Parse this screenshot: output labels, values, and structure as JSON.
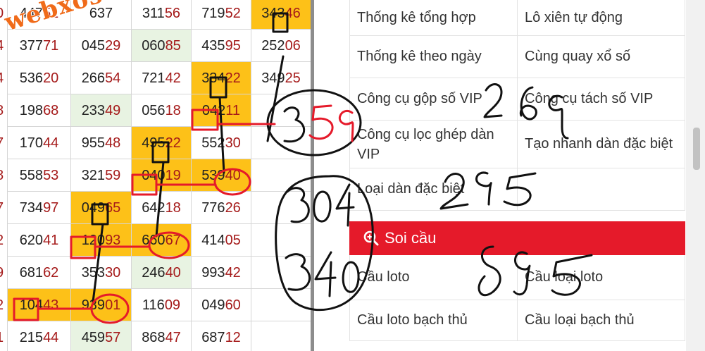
{
  "lotto_rows": [
    {
      "lead": "0",
      "cells": [
        [
          "447",
          "51"
        ],
        [
          "637",
          ""
        ],
        [
          "311",
          "56"
        ],
        [
          "719",
          "52"
        ],
        [
          "343",
          "46"
        ]
      ],
      "hl": [
        null,
        null,
        null,
        null,
        "yellow"
      ]
    },
    {
      "lead": "4",
      "cells": [
        [
          "377",
          "71"
        ],
        [
          "045",
          "29"
        ],
        [
          "060",
          "85"
        ],
        [
          "435",
          "95"
        ],
        [
          "252",
          "06"
        ]
      ],
      "hl": [
        null,
        null,
        "green",
        null,
        null
      ]
    },
    {
      "lead": "4",
      "cells": [
        [
          "536",
          "20"
        ],
        [
          "266",
          "54"
        ],
        [
          "721",
          "42"
        ],
        [
          "334",
          "22"
        ],
        [
          "349",
          "25"
        ]
      ],
      "hl": [
        null,
        null,
        null,
        "yellow",
        null
      ]
    },
    {
      "lead": "8",
      "cells": [
        [
          "198",
          "68"
        ],
        [
          "233",
          "49"
        ],
        [
          "056",
          "18"
        ],
        [
          "042",
          "11"
        ],
        [
          "",
          ""
        ]
      ],
      "hl": [
        null,
        "green",
        null,
        "yellow",
        null
      ]
    },
    {
      "lead": "7",
      "cells": [
        [
          "170",
          "44"
        ],
        [
          "955",
          "48"
        ],
        [
          "495",
          "22"
        ],
        [
          "552",
          "30"
        ],
        [
          "",
          ""
        ]
      ],
      "hl": [
        null,
        null,
        "yellow",
        null,
        null
      ]
    },
    {
      "lead": "8",
      "cells": [
        [
          "558",
          "53"
        ],
        [
          "321",
          "59"
        ],
        [
          "040",
          "19"
        ],
        [
          "539",
          "40"
        ],
        [
          "",
          ""
        ]
      ],
      "hl": [
        null,
        null,
        "yellow",
        "yellow",
        null
      ]
    },
    {
      "lead": "7",
      "cells": [
        [
          "734",
          "97"
        ],
        [
          "049",
          "65"
        ],
        [
          "642",
          "18"
        ],
        [
          "776",
          "26"
        ],
        [
          "",
          ""
        ]
      ],
      "hl": [
        null,
        "yellow",
        null,
        null,
        null
      ]
    },
    {
      "lead": "2",
      "cells": [
        [
          "620",
          "41"
        ],
        [
          "120",
          "93"
        ],
        [
          "660",
          "67"
        ],
        [
          "414",
          "05"
        ],
        [
          "",
          ""
        ]
      ],
      "hl": [
        null,
        "yellow",
        "yellow",
        null,
        null
      ]
    },
    {
      "lead": "9",
      "cells": [
        [
          "681",
          "62"
        ],
        [
          "353",
          "30"
        ],
        [
          "246",
          "40"
        ],
        [
          "993",
          "42"
        ],
        [
          "",
          ""
        ]
      ],
      "hl": [
        null,
        null,
        "green",
        null,
        null
      ]
    },
    {
      "lead": "2",
      "cells": [
        [
          "104",
          "43"
        ],
        [
          "939",
          "01"
        ],
        [
          "116",
          "09"
        ],
        [
          "049",
          "60"
        ],
        [
          "",
          ""
        ]
      ],
      "hl": [
        "yellow",
        "yellow",
        null,
        null,
        null
      ]
    },
    {
      "lead": "1",
      "cells": [
        [
          "215",
          "44"
        ],
        [
          "459",
          "57"
        ],
        [
          "868",
          "47"
        ],
        [
          "687",
          "12"
        ],
        [
          "",
          ""
        ]
      ],
      "hl": [
        null,
        "green",
        null,
        null,
        null
      ]
    }
  ],
  "watermark": "webxoso.net",
  "menu": {
    "items": [
      {
        "left": "Thống kê tổng hợp",
        "right": "Lô xiên tự động"
      },
      {
        "left": "Thống kê theo ngày",
        "right": "Cùng quay xổ số"
      },
      {
        "left": "Công cụ gộp số VIP",
        "right": "Công cụ tách số VIP"
      },
      {
        "left": "Công cụ lọc ghép dàn VIP",
        "right": "Tạo nhanh dàn đặc biệt"
      },
      {
        "left": "Loại dàn đặc biệt",
        "right": ""
      }
    ],
    "section_title": "Soi cầu",
    "section_items": [
      {
        "left": "Cầu loto",
        "right": "Cầu loại loto"
      },
      {
        "left": "Cầu loto bạch thủ",
        "right": "Cầu loại bạch thủ"
      }
    ]
  },
  "handwriting": {
    "n359": "359",
    "n269": "269",
    "n295": "295",
    "n304": "304",
    "n340": "340",
    "n895": "895"
  },
  "colors": {
    "accent_red": "#e51a2a",
    "highlight_yellow": "#fdc118",
    "highlight_green": "#e8f3e2",
    "number_tail": "#a51a1a"
  }
}
